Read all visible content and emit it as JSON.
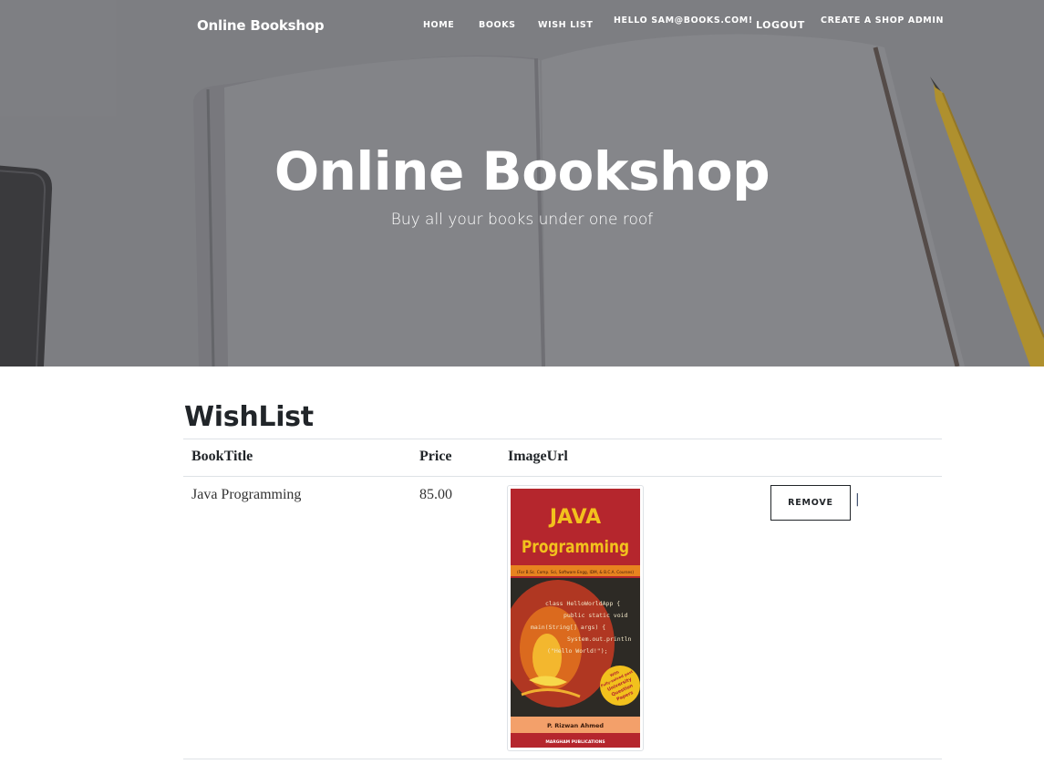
{
  "nav": {
    "brand": "Online Bookshop",
    "items": [
      {
        "label": "HOME"
      },
      {
        "label": "BOOKS"
      },
      {
        "label": "WISH LIST"
      },
      {
        "label": "HELLO SAM@BOOKS.COM!"
      },
      {
        "label": "LOGOUT"
      },
      {
        "label": "CREATE A SHOP ADMIN"
      }
    ]
  },
  "hero": {
    "title": "Online Bookshop",
    "subtitle": "Buy all your books under one roof"
  },
  "wishlist": {
    "heading": "WishList",
    "columns": [
      "BookTitle",
      "Price",
      "ImageUrl"
    ],
    "rows": [
      {
        "title": "Java Programming",
        "price": "85.00",
        "remove_label": "REMOVE",
        "separator": "|",
        "cover": {
          "line1": "JAVA",
          "line2": "Programming",
          "tagline": "(For B.Sc. Comp. Sci, Software Engg, IDM, & B.C.A. Courses)",
          "code": [
            "class HelloWorldApp {",
            "public static void",
            "main(String[] args) {",
            "System.out.println",
            "(\"Hello World!\");"
          ],
          "badge": [
            "With",
            "Fully-solved past",
            "University",
            "Question",
            "Papers"
          ],
          "author": "P. Rizwan Ahmed",
          "publisher": "MARGHAM PUBLICATIONS"
        }
      }
    ]
  },
  "colors": {
    "hero_bg": "#8a8b8f",
    "cover_red": "#b5262d",
    "cover_yellow": "#f2c11d",
    "cover_orange": "#e8831f"
  }
}
